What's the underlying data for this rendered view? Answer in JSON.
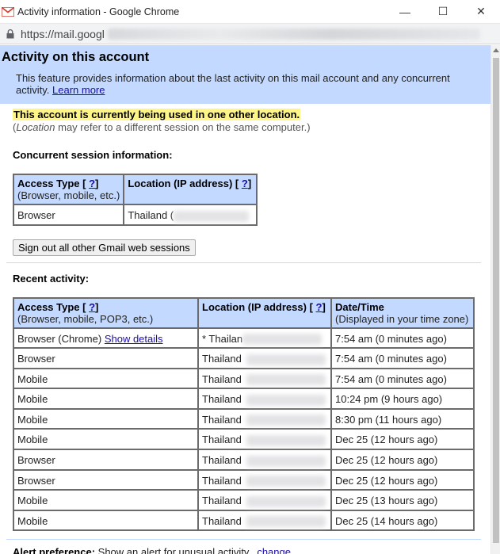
{
  "window": {
    "title": "Activity information - Google Chrome",
    "minimize_glyph": "—",
    "maximize_glyph": "☐",
    "close_glyph": "✕"
  },
  "address_bar": {
    "url": "https://mail.googl"
  },
  "page": {
    "heading": "Activity on this account",
    "description": "This feature provides information about the last activity on this mail account and any concurrent activity.",
    "learn_more": "Learn more",
    "warning": "This account is currently being used in one other location.",
    "note_location": "Location",
    "note_rest": " may refer to a different session on the same computer.)",
    "note_open": "("
  },
  "concurrent": {
    "title": "Concurrent session information:",
    "headers": {
      "access_type": "Access Type [",
      "help": "?",
      "close": "]",
      "access_sub": "(Browser, mobile, etc.)",
      "location": "Location (IP address) ["
    },
    "row": {
      "type": "Browser",
      "location": "Thailand ("
    },
    "signout_button": "Sign out all other Gmail web sessions"
  },
  "recent": {
    "title": "Recent activity:",
    "headers": {
      "access_type": "Access Type [",
      "access_sub": "(Browser, mobile, POP3, etc.)",
      "location": "Location (IP address) [",
      "datetime": "Date/Time",
      "datetime_sub": "(Displayed in your time zone)",
      "help": "?",
      "close": "]"
    },
    "first_row": {
      "type": "Browser (Chrome)",
      "show_details": "Show details",
      "location": "* Thailan",
      "time": "7:54 am (0 minutes ago)"
    },
    "rows": [
      {
        "type": "Browser",
        "location": "Thailand",
        "time": "7:54 am (0 minutes ago)"
      },
      {
        "type": "Mobile",
        "location": "Thailand",
        "time": "7:54 am (0 minutes ago)"
      },
      {
        "type": "Mobile",
        "location": "Thailand",
        "time": "10:24 pm (9 hours ago)"
      },
      {
        "type": "Mobile",
        "location": "Thailand",
        "time": "8:30 pm (11 hours ago)"
      },
      {
        "type": "Mobile",
        "location": "Thailand",
        "time": "Dec 25 (12 hours ago)"
      },
      {
        "type": "Browser",
        "location": "Thailand",
        "time": "Dec 25 (12 hours ago)"
      },
      {
        "type": "Browser",
        "location": "Thailand",
        "time": "Dec 25 (12 hours ago)"
      },
      {
        "type": "Mobile",
        "location": "Thailand",
        "time": "Dec 25 (13 hours ago)"
      },
      {
        "type": "Mobile",
        "location": "Thailand",
        "time": "Dec 25 (14 hours ago)"
      }
    ]
  },
  "alert": {
    "label": "Alert preference:",
    "text": " Show an alert for unusual activity.",
    "change": "change"
  }
}
